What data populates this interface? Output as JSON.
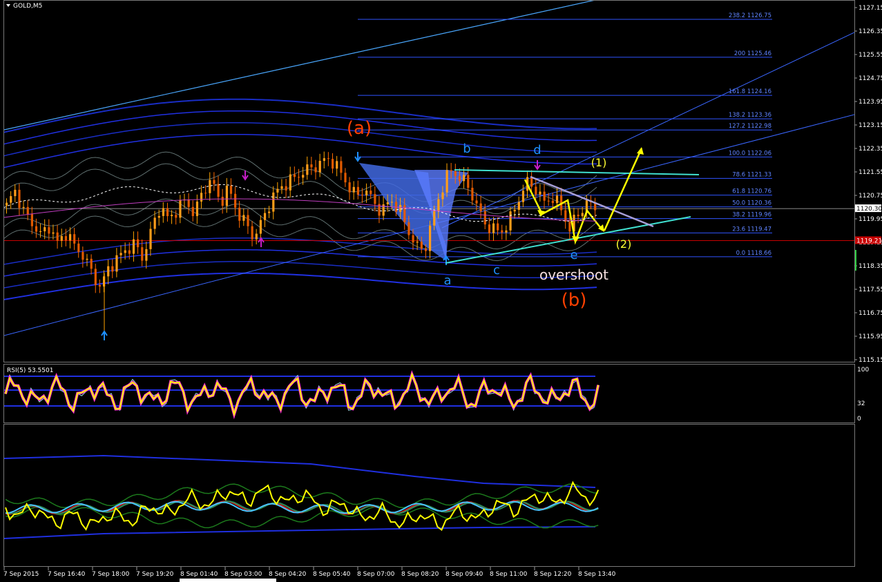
{
  "chart_title": "GOLD,M5",
  "rsi_label": "RSI(5) 53.5501",
  "chart_data": {
    "type": "candlestick",
    "symbol": "GOLD",
    "timeframe": "M5",
    "price_axis": {
      "ylim": [
        1115.0,
        1127.3
      ],
      "tick_labels": [
        "1127.15",
        "1126.35",
        "1125.55",
        "1124.75",
        "1123.95",
        "1123.15",
        "1122.35",
        "1121.55",
        "1120.75",
        "1119.95",
        "1119.15",
        "1118.35",
        "1117.55",
        "1116.75",
        "1115.95",
        "1115.15"
      ]
    },
    "time_axis": {
      "tick_labels": [
        "7 Sep 2015",
        "7 Sep 16:40",
        "7 Sep 18:00",
        "7 Sep 19:20",
        "8 Sep 01:40",
        "8 Sep 03:00",
        "8 Sep 04:20",
        "8 Sep 05:40",
        "8 Sep 07:00",
        "8 Sep 08:20",
        "8 Sep 09:40",
        "8 Sep 11:00",
        "8 Sep 12:20",
        "8 Sep 13:40"
      ]
    },
    "current_price": "1120.30",
    "red_level": {
      "label": "1119.21",
      "value": 1119.21
    },
    "fibonacci": [
      {
        "label": "238.2 1126.75",
        "value": 1126.75
      },
      {
        "label": "200 1125.46",
        "value": 1125.46
      },
      {
        "label": "161.8 1124.16",
        "value": 1124.16
      },
      {
        "label": "138.2 1123.36",
        "value": 1123.36
      },
      {
        "label": "127.2 1122.98",
        "value": 1122.98
      },
      {
        "label": "100.0 1122.06",
        "value": 1122.06
      },
      {
        "label": "78.6 1121.33",
        "value": 1121.33
      },
      {
        "label": "61.8 1120.76",
        "value": 1120.76
      },
      {
        "label": "50.0 1120.36",
        "value": 1120.36
      },
      {
        "label": "38.2 1119.96",
        "value": 1119.96
      },
      {
        "label": "23.6 1119.47",
        "value": 1119.47
      },
      {
        "label": "0.0 1118.66",
        "value": 1118.66
      }
    ],
    "close_path": [
      1120.4,
      1120.9,
      1120.2,
      1119.8,
      1119.4,
      1119.7,
      1119.1,
      1119.5,
      1119.0,
      1118.7,
      1118.1,
      1117.6,
      1118.3,
      1118.6,
      1118.9,
      1119.1,
      1118.6,
      1119.6,
      1120.4,
      1119.9,
      1120.3,
      1120.6,
      1120.1,
      1120.9,
      1121.3,
      1120.5,
      1121.0,
      1120.2,
      1119.8,
      1119.3,
      1119.9,
      1120.6,
      1121.0,
      1121.2,
      1121.4,
      1121.6,
      1121.7,
      1121.9,
      1122.0,
      1121.6,
      1121.1,
      1120.7,
      1121.0,
      1120.5,
      1120.2,
      1120.6,
      1120.3,
      1119.6,
      1119.0,
      1118.9,
      1120.0,
      1121.0,
      1121.6,
      1121.4,
      1121.1,
      1120.5,
      1119.8,
      1119.6,
      1119.5,
      1119.9,
      1120.6,
      1121.2,
      1121.0,
      1120.5,
      1120.7,
      1120.3,
      1119.6,
      1120.1,
      1120.5,
      1120.3
    ]
  },
  "rsi_scale": {
    "top": "100",
    "mid": "32",
    "bottom": "0"
  },
  "wave_labels": {
    "wave_a": "(a)",
    "wave_b": "(b)",
    "a": "a",
    "b": "b",
    "c": "c",
    "d": "d",
    "e": "e",
    "w1": "(1)",
    "w2": "(2)",
    "overshoot": "overshoot"
  },
  "colors": {
    "bull": "#ff8c00",
    "bear": "#ff6600",
    "grid_line": "#2d3fd6",
    "orange_label": "#ff4000",
    "cyan_label": "#1e90ff",
    "yellow": "#ffff00",
    "fib": "#2f54ff",
    "red_level": "#c80000"
  }
}
